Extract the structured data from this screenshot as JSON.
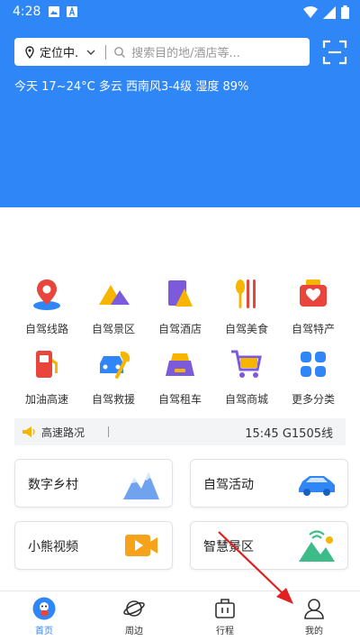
{
  "status_bar": {
    "time": "4:28"
  },
  "header": {
    "location_label": "定位中.",
    "search_placeholder": "搜索目的地/酒店等...",
    "weather": "今天 17~24°C 多云 西南风3-4级 湿度 89%"
  },
  "services": [
    {
      "label": "自驾线路",
      "icon": "route-pin-icon"
    },
    {
      "label": "自驾景区",
      "icon": "mountain-icon"
    },
    {
      "label": "自驾酒店",
      "icon": "hotel-icon"
    },
    {
      "label": "自驾美食",
      "icon": "food-icon"
    },
    {
      "label": "自驾特产",
      "icon": "gift-icon"
    },
    {
      "label": "加油高速",
      "icon": "fuel-icon"
    },
    {
      "label": "自驾救援",
      "icon": "rescue-icon"
    },
    {
      "label": "自驾租车",
      "icon": "rental-car-icon"
    },
    {
      "label": "自驾商城",
      "icon": "cart-icon"
    },
    {
      "label": "更多分类",
      "icon": "grid-icon"
    }
  ],
  "traffic": {
    "label": "高速路况",
    "info": "15:45 G1505线"
  },
  "cards": [
    {
      "label": "数字乡村",
      "icon": "mountain-snow-icon"
    },
    {
      "label": "自驾活动",
      "icon": "car-icon"
    },
    {
      "label": "小熊视频",
      "icon": "video-play-icon"
    },
    {
      "label": "智慧景区",
      "icon": "smart-scenic-icon"
    }
  ],
  "tabbar": {
    "items": [
      {
        "label": "首页",
        "icon": "home-icon",
        "active": true
      },
      {
        "label": "周边",
        "icon": "planet-icon",
        "active": false
      },
      {
        "label": "行程",
        "icon": "luggage-icon",
        "active": false
      },
      {
        "label": "我的",
        "icon": "user-icon",
        "active": false
      }
    ]
  },
  "colors": {
    "primary": "#2f86f6",
    "accent_red": "#e8453c",
    "accent_yellow": "#f7b500",
    "accent_purple": "#7b5bdc"
  }
}
